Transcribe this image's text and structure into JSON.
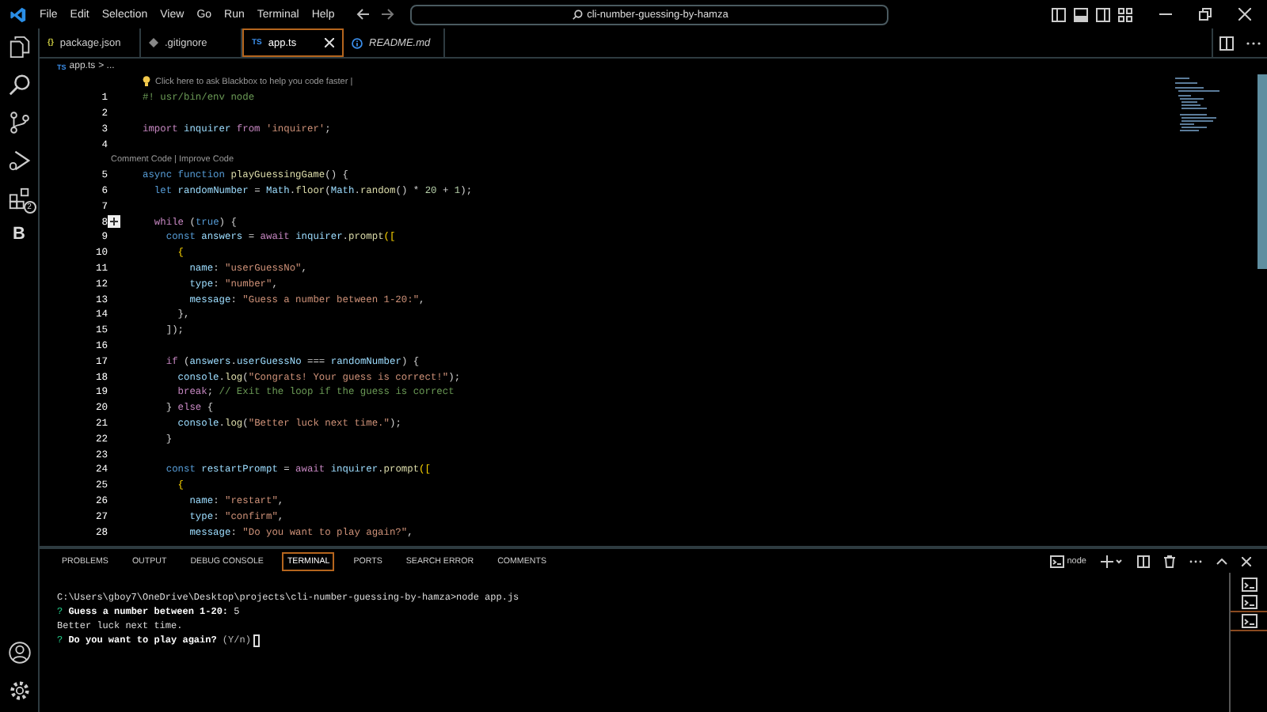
{
  "title_bar": {
    "menu": [
      "File",
      "Edit",
      "Selection",
      "View",
      "Go",
      "Run",
      "Terminal",
      "Help"
    ],
    "search": {
      "value": "cli-number-guessing-by-hamza"
    }
  },
  "activity_bar": {
    "top": [
      {
        "kind": "files"
      },
      {
        "kind": "search"
      },
      {
        "kind": "source-control"
      },
      {
        "kind": "run"
      },
      {
        "kind": "extensions",
        "badge": "2"
      },
      {
        "kind": "letter",
        "label": "B"
      }
    ],
    "bottom": [
      {
        "kind": "account"
      },
      {
        "kind": "settings"
      }
    ]
  },
  "tabs": [
    {
      "label": "package.json",
      "kind": "json",
      "badge": "{}",
      "selected": false,
      "preview": false
    },
    {
      "label": ".gitignore",
      "kind": "diamond",
      "selected": false,
      "preview": false
    },
    {
      "label": "app.ts",
      "kind": "ts",
      "badge": "TS",
      "selected": true,
      "preview": false
    },
    {
      "label": "README.md",
      "kind": "info",
      "selected": false,
      "preview": true
    }
  ],
  "breadcrumb": {
    "badge": "TS",
    "file": "app.ts",
    "rest": "> ..."
  },
  "editor": {
    "lines": [
      {
        "kind": "hint",
        "text": "Click here to ask Blackbox to help you code faster |"
      },
      {
        "kind": "code",
        "num": "1",
        "tokens": [
          {
            "text": "#! usr/bin/env node",
            "kind": "comment"
          }
        ]
      },
      {
        "kind": "code",
        "num": "2"
      },
      {
        "kind": "code",
        "num": "3",
        "tokens": [
          {
            "text": "import",
            "kind": "keyword"
          },
          {
            "text": " inquirer ",
            "kind": "variable"
          },
          {
            "text": "from",
            "kind": "keyword"
          },
          {
            "text": " 'inquirer'",
            "kind": "string"
          },
          {
            "text": ";",
            "kind": "plain"
          }
        ]
      },
      {
        "kind": "code",
        "num": "4"
      },
      {
        "kind": "lens",
        "text": "Comment Code | Improve Code"
      },
      {
        "kind": "code",
        "num": "5",
        "tokens": [
          {
            "text": "async function",
            "kind": "decl"
          },
          {
            "text": " playGuessingGame",
            "kind": "function"
          },
          {
            "text": "() {",
            "kind": "plain"
          }
        ]
      },
      {
        "kind": "code",
        "num": "6",
        "tokens": [
          {
            "text": "  let",
            "kind": "decl"
          },
          {
            "text": " randomNumber",
            "kind": "variable"
          },
          {
            "text": " = ",
            "kind": "plain"
          },
          {
            "text": "Math",
            "kind": "variable"
          },
          {
            "text": ".",
            "kind": "plain"
          },
          {
            "text": "floor",
            "kind": "function"
          },
          {
            "text": "(",
            "kind": "plain"
          },
          {
            "text": "Math",
            "kind": "variable"
          },
          {
            "text": ".",
            "kind": "plain"
          },
          {
            "text": "random",
            "kind": "function"
          },
          {
            "text": "() * ",
            "kind": "plain"
          },
          {
            "text": "20",
            "kind": "number"
          },
          {
            "text": " + ",
            "kind": "plain"
          },
          {
            "text": "1",
            "kind": "number"
          },
          {
            "text": ");",
            "kind": "plain"
          }
        ]
      },
      {
        "kind": "code",
        "num": "7"
      },
      {
        "kind": "code",
        "num": "8",
        "add_button": true,
        "tokens": [
          {
            "text": "  while",
            "kind": "keyword"
          },
          {
            "text": " (",
            "kind": "plain"
          },
          {
            "text": "true",
            "kind": "decl"
          },
          {
            "text": ") {",
            "kind": "plain"
          }
        ]
      },
      {
        "kind": "code",
        "num": "9",
        "tokens": [
          {
            "text": "    const",
            "kind": "decl"
          },
          {
            "text": " answers",
            "kind": "variable"
          },
          {
            "text": " = ",
            "kind": "plain"
          },
          {
            "text": "await",
            "kind": "keyword"
          },
          {
            "text": " inquirer",
            "kind": "variable"
          },
          {
            "text": ".",
            "kind": "plain"
          },
          {
            "text": "prompt",
            "kind": "function"
          },
          {
            "text": "([",
            "kind": "bracket"
          }
        ]
      },
      {
        "kind": "code",
        "num": "10",
        "tokens": [
          {
            "text": "      {",
            "kind": "bracket"
          }
        ]
      },
      {
        "kind": "code",
        "num": "11",
        "tokens": [
          {
            "text": "        name",
            "kind": "variable"
          },
          {
            "text": ": ",
            "kind": "plain"
          },
          {
            "text": "\"userGuessNo\"",
            "kind": "string"
          },
          {
            "text": ",",
            "kind": "plain"
          }
        ]
      },
      {
        "kind": "code",
        "num": "12",
        "tokens": [
          {
            "text": "        type",
            "kind": "variable"
          },
          {
            "text": ": ",
            "kind": "plain"
          },
          {
            "text": "\"number\"",
            "kind": "string"
          },
          {
            "text": ",",
            "kind": "plain"
          }
        ]
      },
      {
        "kind": "code",
        "num": "13",
        "tokens": [
          {
            "text": "        message",
            "kind": "variable"
          },
          {
            "text": ": ",
            "kind": "plain"
          },
          {
            "text": "\"Guess a number between 1-20:\"",
            "kind": "string"
          },
          {
            "text": ",",
            "kind": "plain"
          }
        ]
      },
      {
        "kind": "code",
        "num": "14",
        "tokens": [
          {
            "text": "      },",
            "kind": "plain"
          }
        ]
      },
      {
        "kind": "code",
        "num": "15",
        "tokens": [
          {
            "text": "    ]);",
            "kind": "plain"
          }
        ]
      },
      {
        "kind": "code",
        "num": "16"
      },
      {
        "kind": "code",
        "num": "17",
        "tokens": [
          {
            "text": "    if",
            "kind": "keyword"
          },
          {
            "text": " (",
            "kind": "plain"
          },
          {
            "text": "answers",
            "kind": "variable"
          },
          {
            "text": ".",
            "kind": "plain"
          },
          {
            "text": "userGuessNo",
            "kind": "variable"
          },
          {
            "text": " === ",
            "kind": "plain"
          },
          {
            "text": "randomNumber",
            "kind": "variable"
          },
          {
            "text": ") {",
            "kind": "plain"
          }
        ]
      },
      {
        "kind": "code",
        "num": "18",
        "tokens": [
          {
            "text": "      console",
            "kind": "variable"
          },
          {
            "text": ".",
            "kind": "plain"
          },
          {
            "text": "log",
            "kind": "function"
          },
          {
            "text": "(",
            "kind": "plain"
          },
          {
            "text": "\"Congrats! Your guess is correct!\"",
            "kind": "string"
          },
          {
            "text": ");",
            "kind": "plain"
          }
        ]
      },
      {
        "kind": "code",
        "num": "19",
        "tokens": [
          {
            "text": "      break",
            "kind": "keyword"
          },
          {
            "text": "; ",
            "kind": "plain"
          },
          {
            "text": "// Exit the loop if the guess is correct",
            "kind": "comment"
          }
        ]
      },
      {
        "kind": "code",
        "num": "20",
        "tokens": [
          {
            "text": "    } ",
            "kind": "plain"
          },
          {
            "text": "else",
            "kind": "keyword"
          },
          {
            "text": " {",
            "kind": "plain"
          }
        ]
      },
      {
        "kind": "code",
        "num": "21",
        "tokens": [
          {
            "text": "      console",
            "kind": "variable"
          },
          {
            "text": ".",
            "kind": "plain"
          },
          {
            "text": "log",
            "kind": "function"
          },
          {
            "text": "(",
            "kind": "plain"
          },
          {
            "text": "\"Better luck next time.\"",
            "kind": "string"
          },
          {
            "text": ");",
            "kind": "plain"
          }
        ]
      },
      {
        "kind": "code",
        "num": "22",
        "tokens": [
          {
            "text": "    }",
            "kind": "plain"
          }
        ]
      },
      {
        "kind": "code",
        "num": "23"
      },
      {
        "kind": "code",
        "num": "24",
        "tokens": [
          {
            "text": "    const",
            "kind": "decl"
          },
          {
            "text": " restartPrompt",
            "kind": "variable"
          },
          {
            "text": " = ",
            "kind": "plain"
          },
          {
            "text": "await",
            "kind": "keyword"
          },
          {
            "text": " inquirer",
            "kind": "variable"
          },
          {
            "text": ".",
            "kind": "plain"
          },
          {
            "text": "prompt",
            "kind": "function"
          },
          {
            "text": "([",
            "kind": "bracket"
          }
        ]
      },
      {
        "kind": "code",
        "num": "25",
        "tokens": [
          {
            "text": "      {",
            "kind": "bracket"
          }
        ]
      },
      {
        "kind": "code",
        "num": "26",
        "tokens": [
          {
            "text": "        name",
            "kind": "variable"
          },
          {
            "text": ": ",
            "kind": "plain"
          },
          {
            "text": "\"restart\"",
            "kind": "string"
          },
          {
            "text": ",",
            "kind": "plain"
          }
        ]
      },
      {
        "kind": "code",
        "num": "27",
        "tokens": [
          {
            "text": "        type",
            "kind": "variable"
          },
          {
            "text": ": ",
            "kind": "plain"
          },
          {
            "text": "\"confirm\"",
            "kind": "string"
          },
          {
            "text": ",",
            "kind": "plain"
          }
        ]
      },
      {
        "kind": "code",
        "num": "28",
        "tokens": [
          {
            "text": "        message",
            "kind": "variable"
          },
          {
            "text": ": ",
            "kind": "plain"
          },
          {
            "text": "\"Do you want to play again?\"",
            "kind": "string"
          },
          {
            "text": ",",
            "kind": "plain"
          }
        ]
      }
    ]
  },
  "panel": {
    "tabs": [
      {
        "label": "PROBLEMS",
        "selected": false
      },
      {
        "label": "OUTPUT",
        "selected": false
      },
      {
        "label": "DEBUG CONSOLE",
        "selected": false
      },
      {
        "label": "TERMINAL",
        "selected": true
      },
      {
        "label": "PORTS",
        "selected": false
      },
      {
        "label": "SEARCH ERROR",
        "selected": false
      },
      {
        "label": "COMMENTS",
        "selected": false
      }
    ],
    "terminal_name": "node",
    "terminal": [
      {
        "segments": [
          {
            "text": "C:\\Users\\gboy7\\OneDrive\\Desktop\\projects\\cli-number-guessing-by-hamza>node app.js",
            "kind": "plain"
          }
        ]
      },
      {
        "segments": [
          {
            "text": "?",
            "kind": "prompt"
          },
          {
            "text": " Guess a number between 1-20:",
            "kind": "bold"
          },
          {
            "text": " 5",
            "kind": "plain"
          }
        ]
      },
      {
        "segments": [
          {
            "text": "Better luck next time.",
            "kind": "plain"
          }
        ]
      },
      {
        "segments": [
          {
            "text": "?",
            "kind": "prompt"
          },
          {
            "text": " Do you want to play again?",
            "kind": "bold"
          },
          {
            "text": " (Y/n)",
            "kind": "dim"
          }
        ],
        "cursor": true
      }
    ],
    "sessions": [
      {
        "selected": false
      },
      {
        "selected": false
      },
      {
        "selected": true
      }
    ]
  }
}
